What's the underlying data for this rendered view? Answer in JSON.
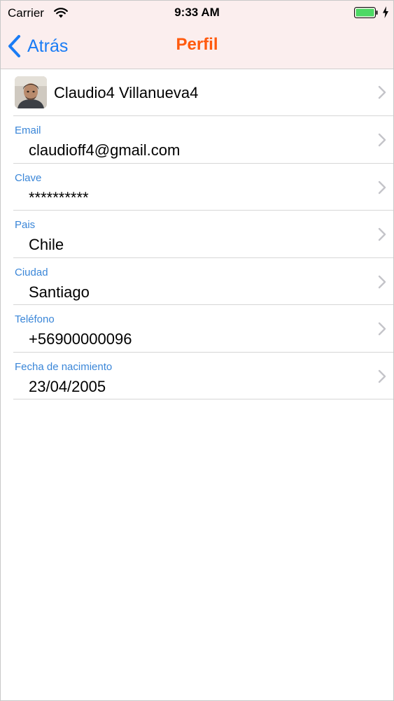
{
  "status_bar": {
    "carrier": "Carrier",
    "time": "9:33 AM",
    "icons": [
      "wifi-icon",
      "battery-icon",
      "charging-bolt-icon"
    ]
  },
  "nav": {
    "back_label": "Atrás",
    "title": "Perfil",
    "back_color": "#1a7cf5",
    "title_color": "#ff5a0e"
  },
  "profile": {
    "name": "Claudio4 Villanueva4"
  },
  "fields": [
    {
      "label": "Email",
      "value": "claudioff4@gmail.com"
    },
    {
      "label": "Clave",
      "value": "**********"
    },
    {
      "label": "Pais",
      "value": "Chile"
    },
    {
      "label": "Ciudad",
      "value": "Santiago"
    },
    {
      "label": "Teléfono",
      "value": "+56900000096"
    },
    {
      "label": "Fecha de nacimiento",
      "value": "23/04/2005"
    }
  ],
  "colors": {
    "nav_background": "#fbeeee",
    "field_label": "#3a86d8",
    "battery": "#4cd964"
  }
}
